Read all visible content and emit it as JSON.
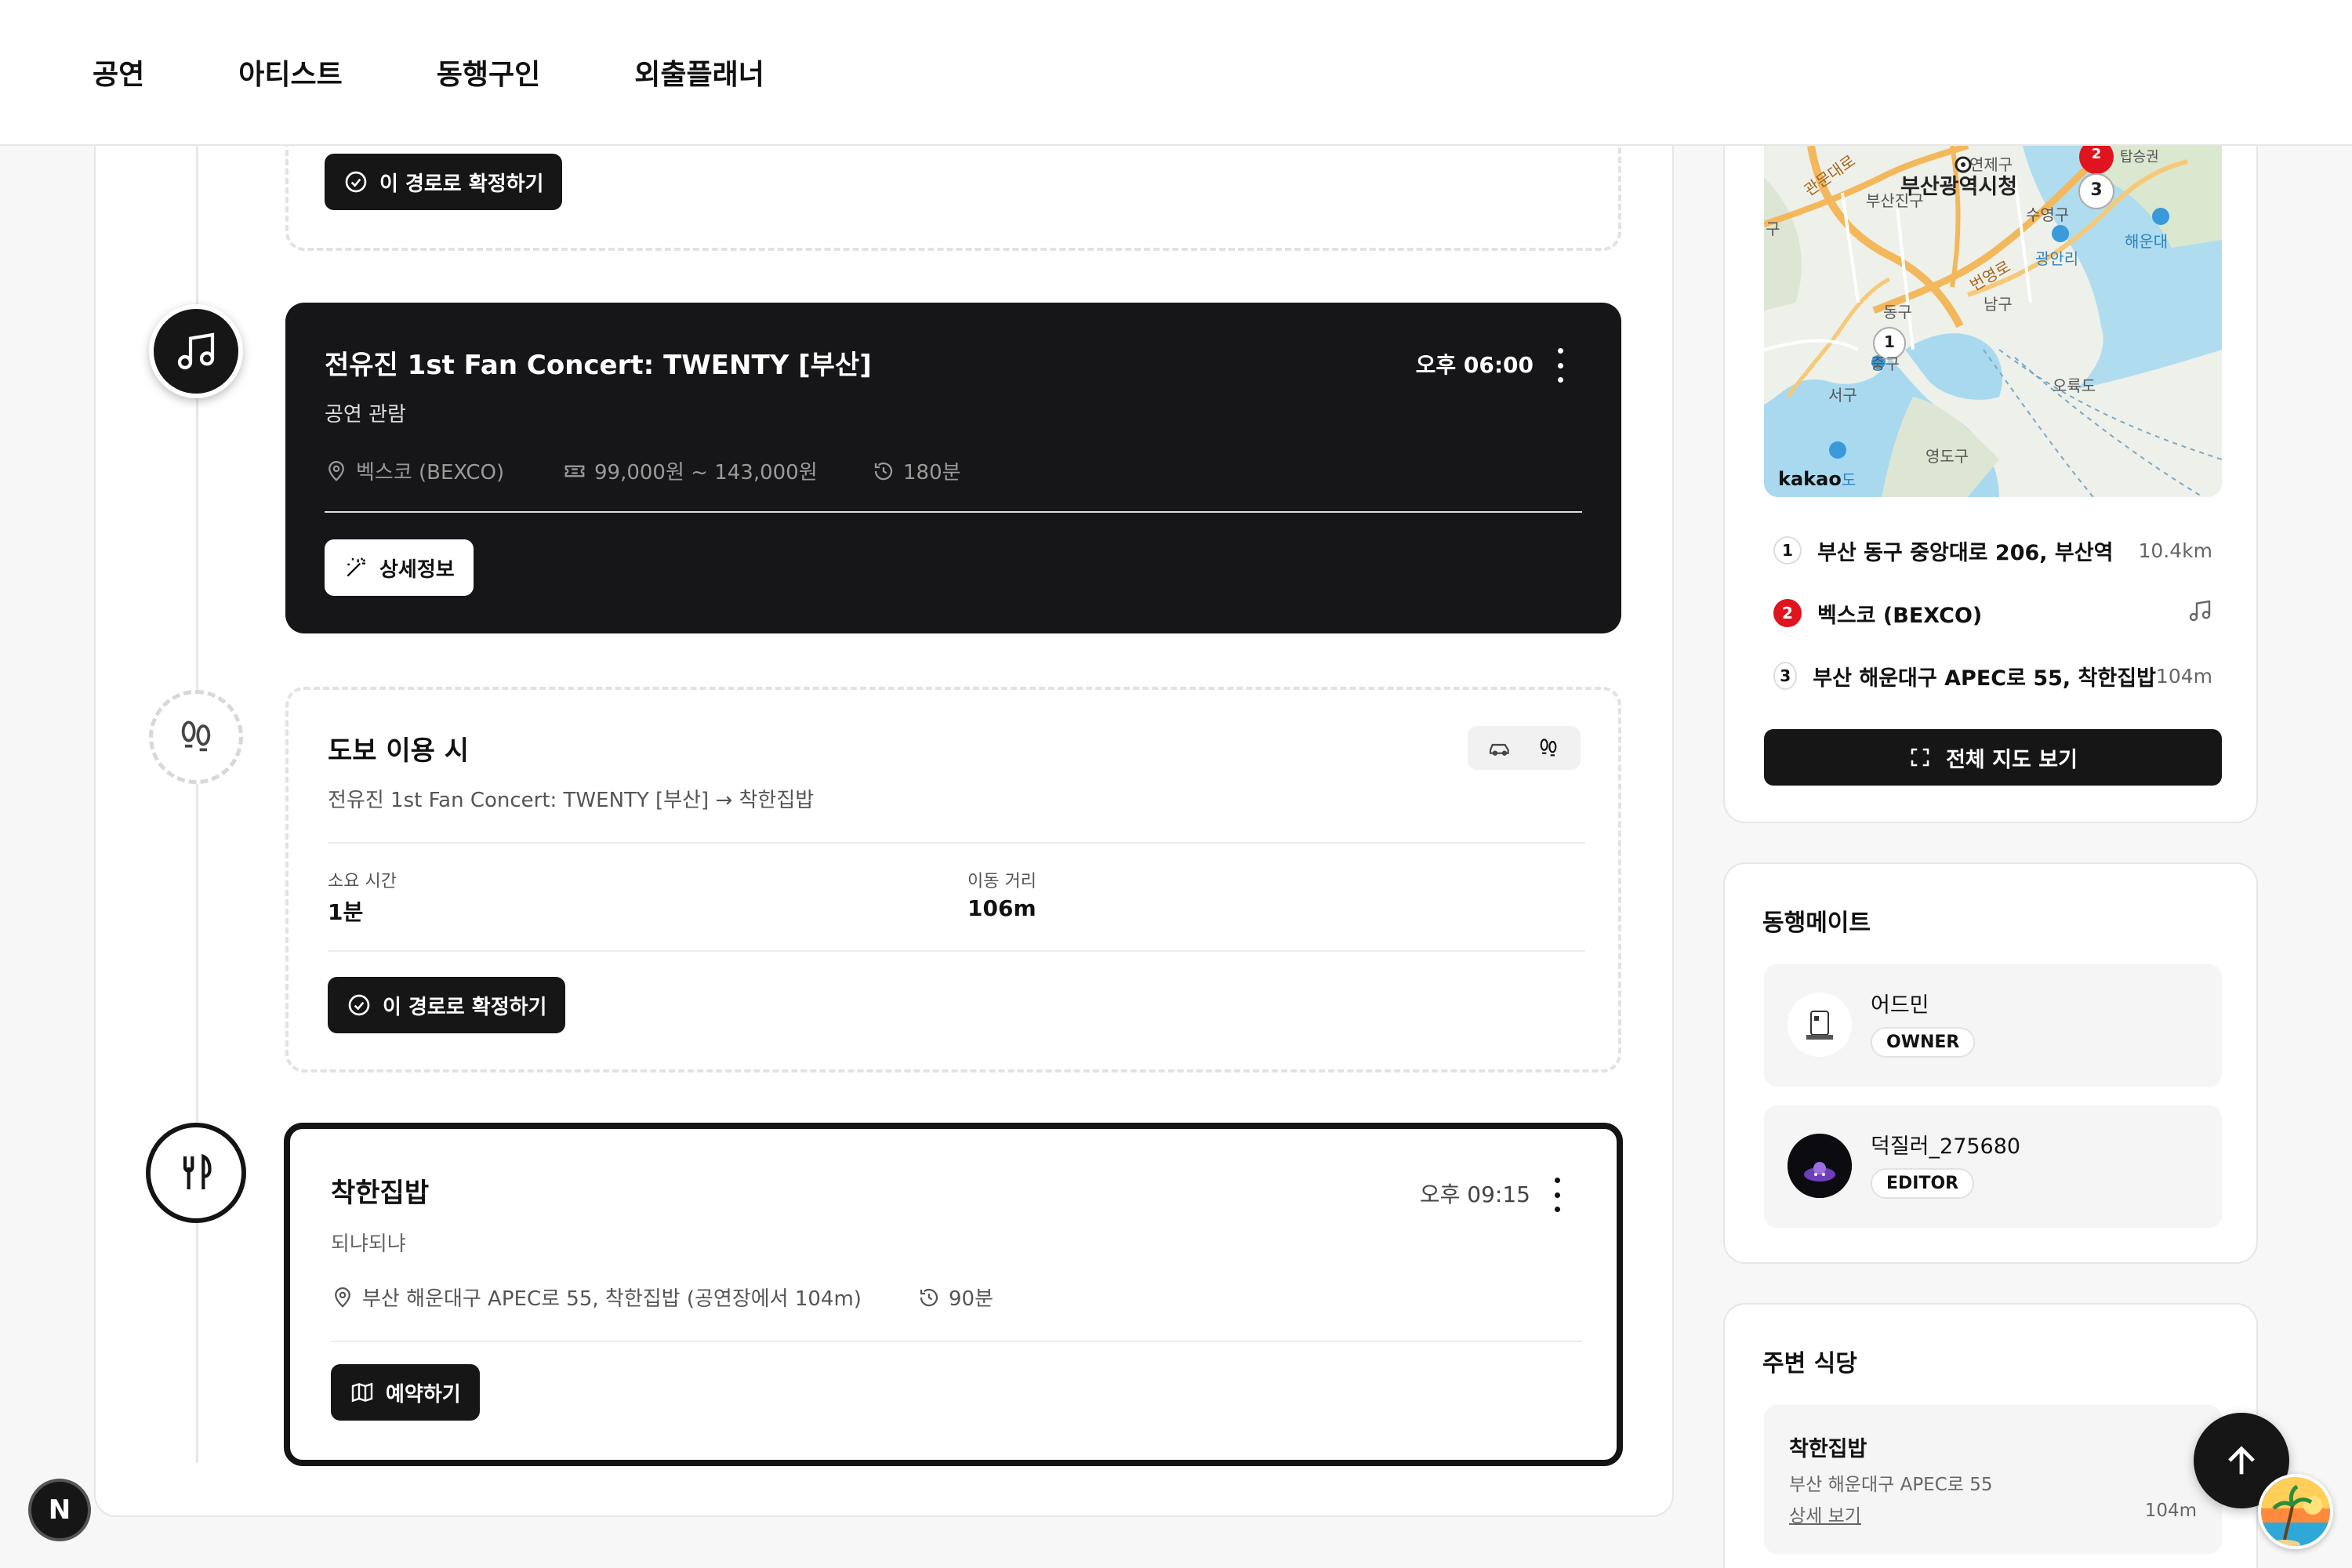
{
  "nav": {
    "items": [
      "공연",
      "아티스트",
      "동행구인",
      "외출플래너"
    ]
  },
  "top_confirm": {
    "label": "이 경로로 확정하기"
  },
  "concert": {
    "title": "전유진 1st Fan Concert: TWENTY [부산]",
    "subtitle": "공연 관람",
    "time": "오후 06:00",
    "venue": "벡스코 (BEXCO)",
    "price": "99,000원 ~ 143,000원",
    "duration": "180분",
    "detail_label": "상세정보"
  },
  "walk": {
    "title": "도보 이용 시",
    "route": "전유진 1st Fan Concert: TWENTY [부산] → 착한집밥",
    "time_label": "소요 시간",
    "time_value": "1분",
    "distance_label": "이동 거리",
    "distance_value": "106m",
    "confirm_label": "이 경로로 확정하기",
    "modes": [
      "car-icon",
      "footsteps-icon"
    ]
  },
  "meal": {
    "title": "착한집밥",
    "subtitle": "되냐되냐",
    "time": "오후 09:15",
    "address": "부산 해운대구 APEC로 55, 착한집밥 (공연장에서 104m)",
    "duration": "90분",
    "reserve_label": "예약하기"
  },
  "map": {
    "labels": {
      "city_hall": "부산광역시청",
      "yeonje": "연제구",
      "busanjin": "부산진구",
      "suyeong": "수영구",
      "haeundae": "해운대",
      "gwangalli": "광안리",
      "dong": "동구",
      "nam": "남구",
      "jung": "중구",
      "seo": "서구",
      "oryukdo": "오륙도",
      "yeongdo": "영도구",
      "gu_left": "구",
      "road_a": "번영로",
      "road_b": "관문대로",
      "top_right": "탑승권",
      "kakao": "kakao",
      "kakao_suffix": "도"
    },
    "pins": [
      "1",
      "2",
      "3"
    ]
  },
  "route_list": [
    {
      "num": "1",
      "name": "부산 동구 중앙대로 206, 부산역",
      "dist": "10.4km"
    },
    {
      "num": "2",
      "name": "벡스코 (BEXCO)",
      "dist": ""
    },
    {
      "num": "3",
      "name": "부산 해운대구 APEC로 55, 착한집밥",
      "dist": "104m"
    }
  ],
  "full_map_label": "전체 지도 보기",
  "mates": {
    "title": "동행메이트",
    "list": [
      {
        "name": "어드민",
        "role": "OWNER"
      },
      {
        "name": "덕질러_275680",
        "role": "EDITOR"
      }
    ]
  },
  "restaurants": {
    "title": "주변 식당",
    "item": {
      "name": "착한집밥",
      "address": "부산 해운대구 APEC로 55",
      "link": "상세 보기",
      "dist": "104m"
    }
  },
  "next_badge": "N",
  "colors": {
    "accent_red": "#e0141e",
    "dark": "#161616",
    "water": "#a9d9ef"
  }
}
